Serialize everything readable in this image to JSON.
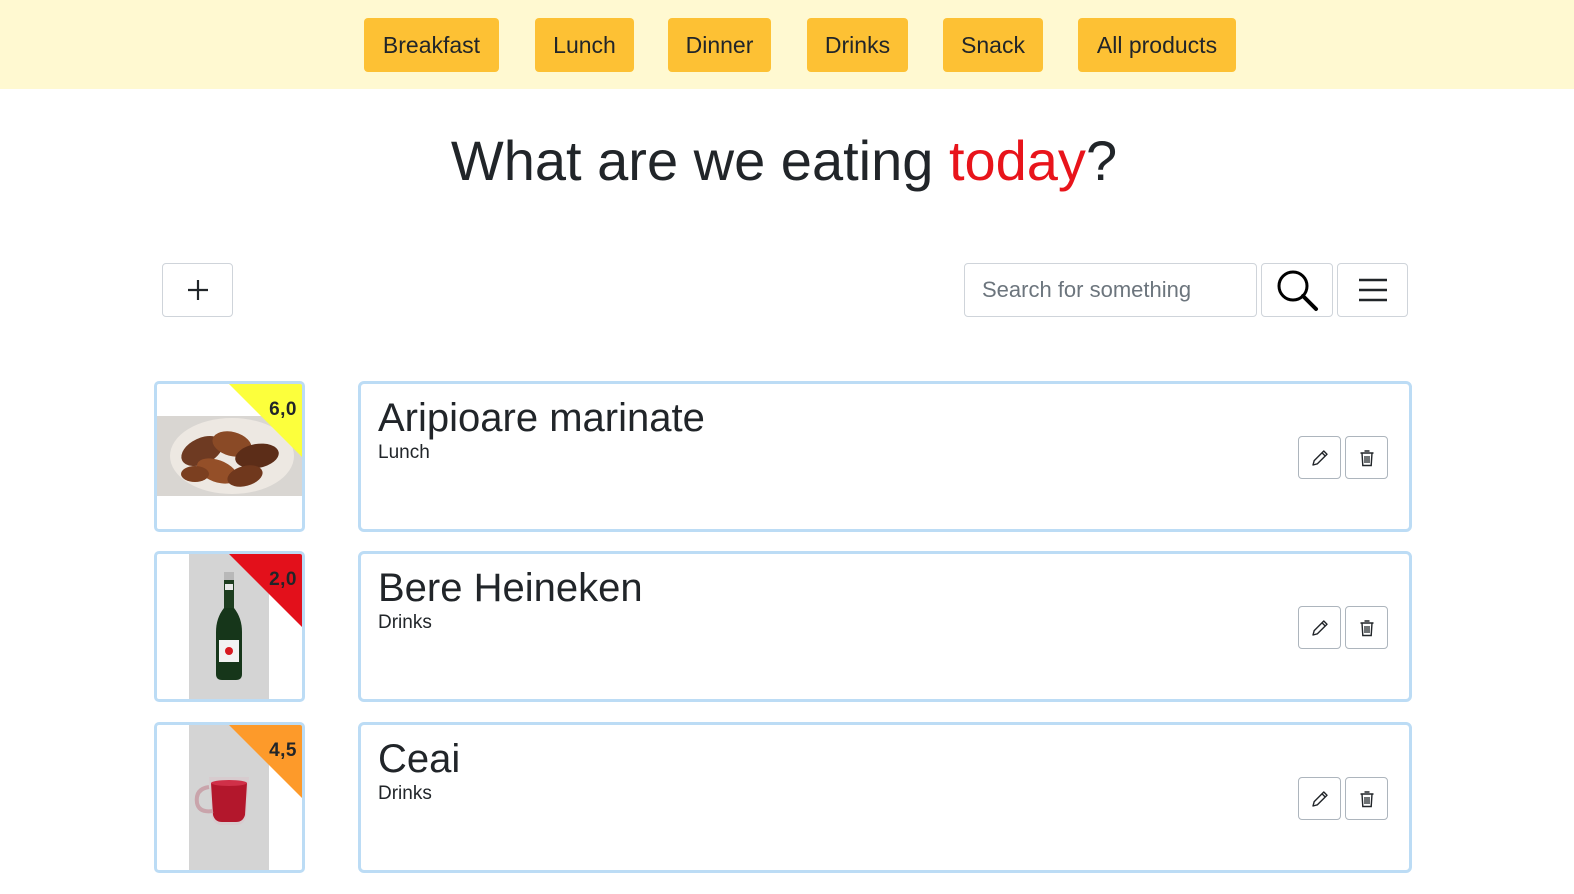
{
  "nav": {
    "categories": [
      "Breakfast",
      "Lunch",
      "Dinner",
      "Drinks",
      "Snack",
      "All products"
    ]
  },
  "heading": {
    "prefix": "What are we eating ",
    "highlight": "today",
    "suffix": "?"
  },
  "toolbar": {
    "add_icon": "plus-icon",
    "search_placeholder": "Search for something",
    "search_icon": "magnifier-icon",
    "menu_icon": "hamburger-menu-icon"
  },
  "products": [
    {
      "name": "Aripioare marinate",
      "category": "Lunch",
      "rating": "6,0",
      "rating_color": "#fcff3c",
      "image": "chicken-wings-image"
    },
    {
      "name": "Bere Heineken",
      "category": "Drinks",
      "rating": "2,0",
      "rating_color": "#e3101b",
      "image": "beer-bottle-image"
    },
    {
      "name": "Ceai",
      "category": "Drinks",
      "rating": "4,5",
      "rating_color": "#fd9a2a",
      "image": "tea-mug-image"
    }
  ],
  "item_actions": {
    "edit_icon": "pencil-icon",
    "delete_icon": "trash-icon"
  },
  "colors": {
    "topbar_bg": "#fff9d1",
    "category_button": "#fdc134",
    "heading_accent": "#e8141b",
    "card_border": "#bcdcf5"
  }
}
